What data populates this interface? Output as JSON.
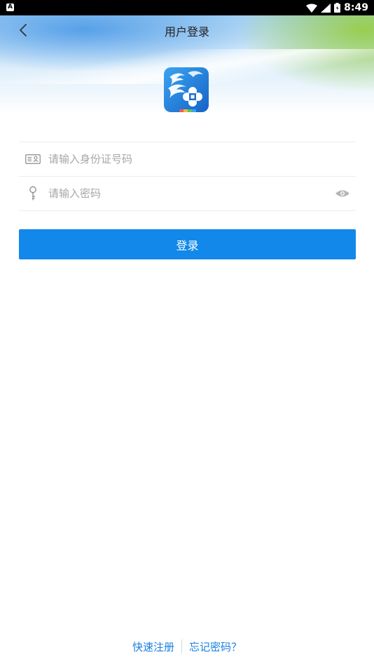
{
  "status_bar": {
    "time": "8:49",
    "icons": [
      "notification-a-icon",
      "wifi-icon",
      "signal-icon",
      "battery-icon"
    ]
  },
  "header": {
    "title": "用户登录",
    "back_icon": "chevron-left-icon"
  },
  "logo": {
    "icon": "app-logo"
  },
  "form": {
    "id_field": {
      "placeholder": "请输入身份证号码",
      "value": "",
      "icon": "id-card-icon"
    },
    "password_field": {
      "placeholder": "请输入密码",
      "value": "",
      "icon": "key-icon",
      "toggle_icon": "eye-icon"
    }
  },
  "login_button": {
    "label": "登录"
  },
  "footer": {
    "register_label": "快速注册",
    "forgot_label": "忘记密码？"
  },
  "colors": {
    "accent": "#1188ea",
    "link": "#1a7fe0",
    "placeholder": "#a7a7a7",
    "divider": "#ececec"
  }
}
